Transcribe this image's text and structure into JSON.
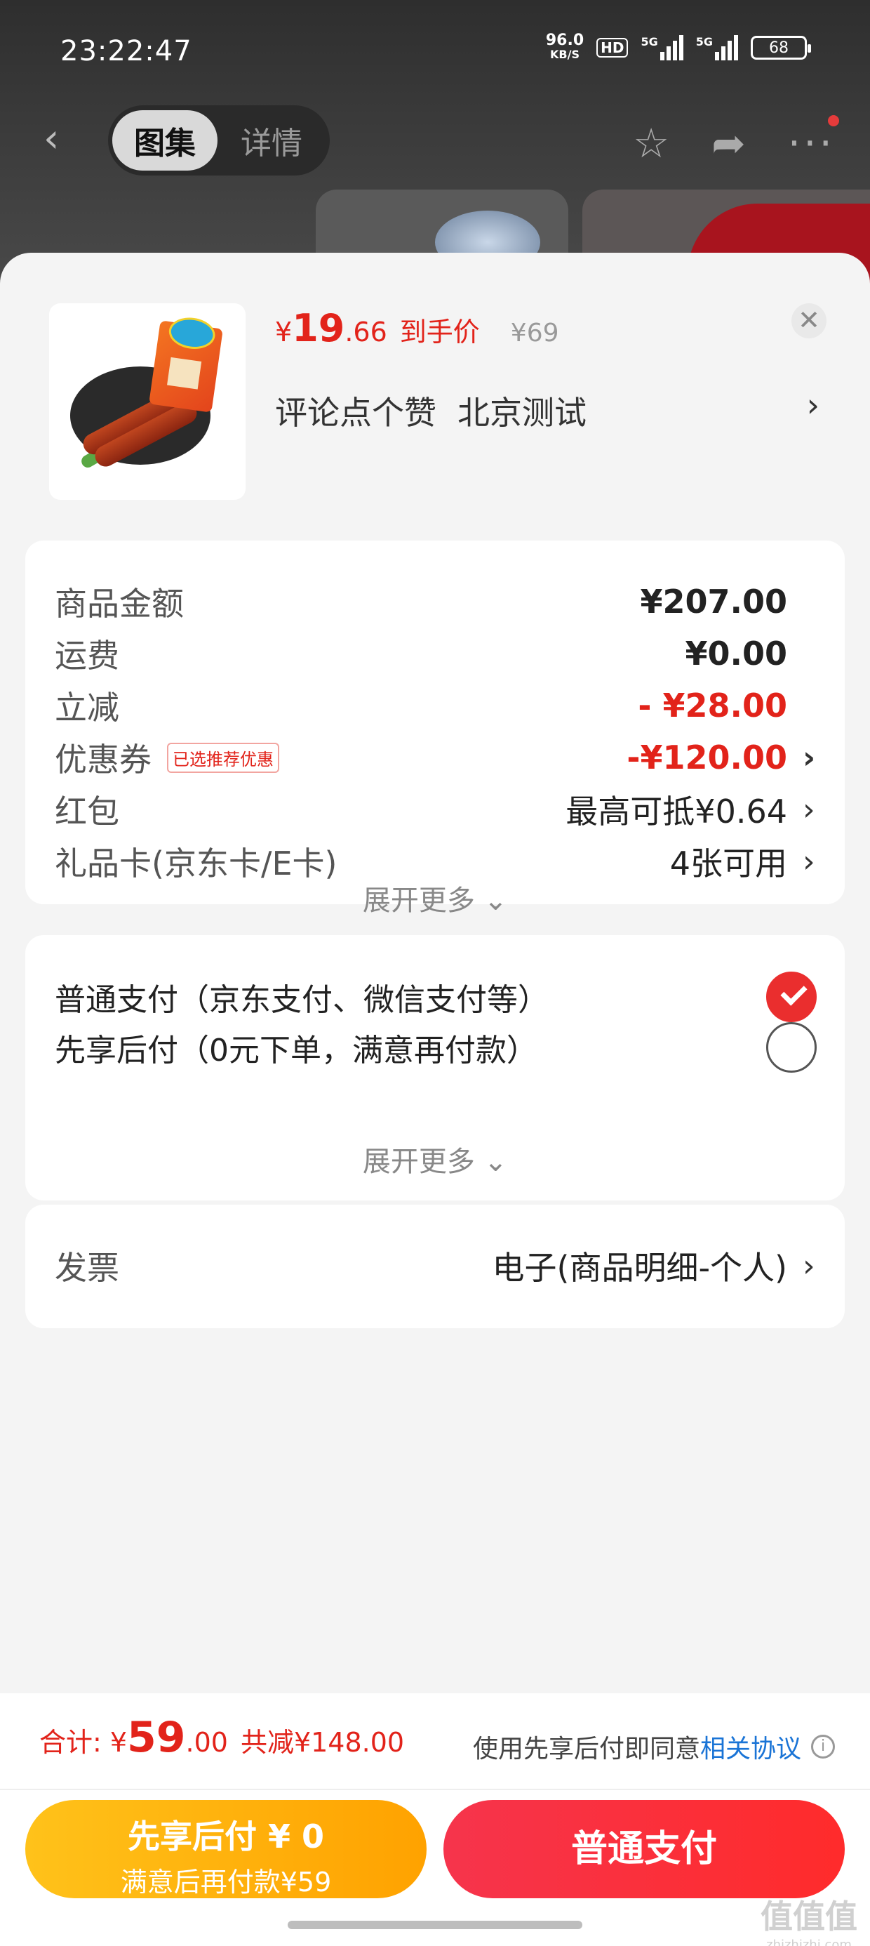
{
  "status_bar": {
    "time": "23:22:47",
    "net_speed": "96.0",
    "net_unit": "KB/S",
    "hd": "HD",
    "sig1": "5G",
    "sig2": "5G",
    "battery": "68"
  },
  "nav": {
    "tab_gallery": "图集",
    "tab_detail": "详情"
  },
  "product": {
    "price_symbol": "¥",
    "price_int": "19",
    "price_dec": ".66",
    "price_label": "到手价",
    "original_price": "¥69",
    "tag1": "评论点个赞",
    "tag2": "北京测试"
  },
  "summary": {
    "goods_label": "商品金额",
    "goods_value": "¥207.00",
    "shipping_label": "运费",
    "shipping_value": "¥0.00",
    "discount_label": "立减",
    "discount_value": "- ¥28.00",
    "coupon_label": "优惠券",
    "coupon_badge": "已选推荐优惠",
    "coupon_value": "-¥120.00",
    "redpacket_label": "红包",
    "redpacket_value": "最高可抵¥0.64",
    "giftcard_label": "礼品卡(京东卡/E卡)",
    "giftcard_value": "4张可用",
    "expand": "展开更多"
  },
  "payment": {
    "normal": "普通支付（京东支付、微信支付等）",
    "normal_selected": true,
    "later": "先享后付（0元下单，满意再付款）",
    "later_selected": false,
    "expand": "展开更多"
  },
  "invoice": {
    "label": "发票",
    "value": "电子(商品明细-个人)"
  },
  "footer": {
    "total_label": "合计:",
    "total_symbol": "¥",
    "total_int": "59",
    "total_dec": ".00",
    "total_saved": "共减¥148.00",
    "agree_text": "使用先享后付即同意",
    "agree_link": "相关协议",
    "later_btn_line1": "先享后付 ¥ 0",
    "later_btn_line2": "满意后再付款¥59",
    "pay_btn": "普通支付"
  },
  "watermark": {
    "line1": "值值值",
    "line2": "zhizhizhi.com"
  },
  "colors": {
    "accent_red": "#e2231a",
    "later_yellow": "#ffb000",
    "pay_red": "#f6344c",
    "link_blue": "#1a74d6"
  }
}
